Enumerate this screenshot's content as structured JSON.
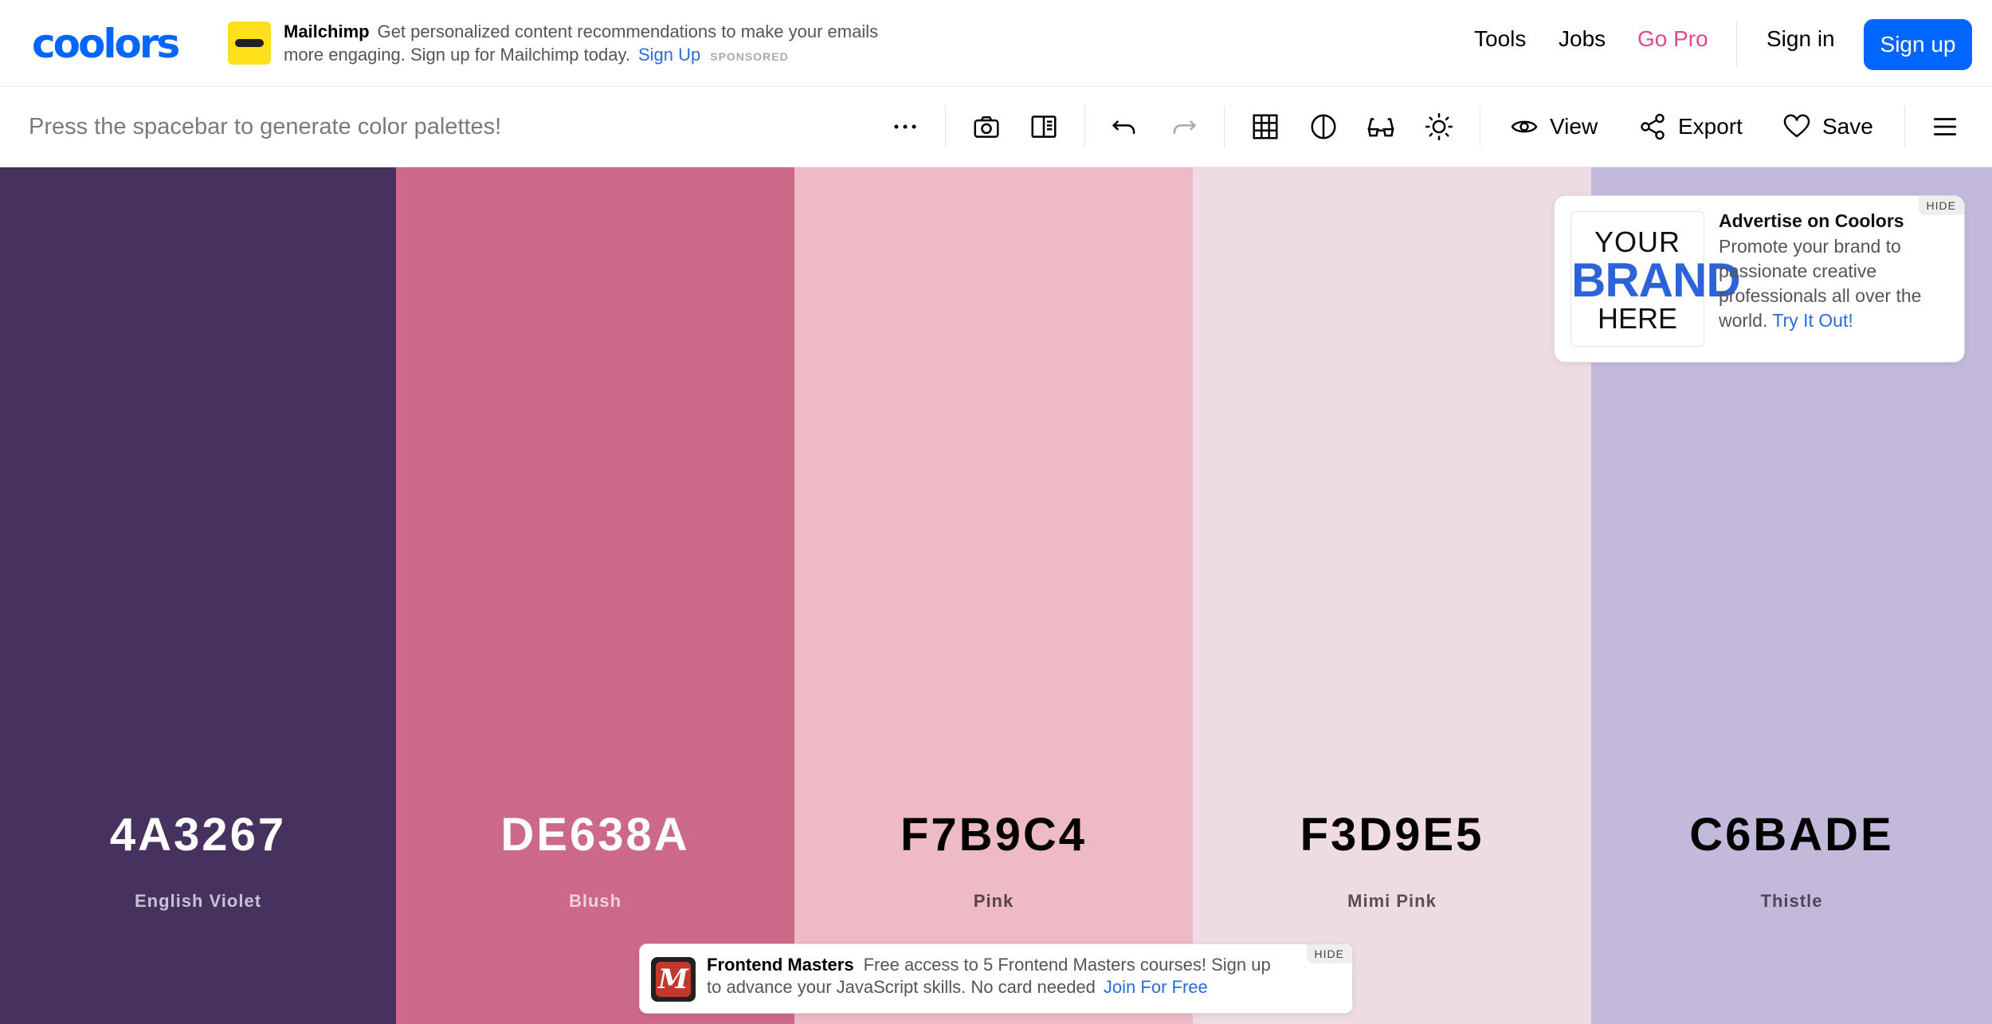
{
  "header": {
    "logo": "coolors",
    "ad": {
      "brand": "Mailchimp",
      "text": "Get personalized content recommendations to make your emails more engaging. Sign up for Mailchimp today.",
      "link": "Sign Up",
      "sponsored": "SPONSORED"
    },
    "nav": {
      "tools": "Tools",
      "jobs": "Jobs",
      "gopro": "Go Pro",
      "signin": "Sign in",
      "signup": "Sign up"
    },
    "colors": {
      "accent": "#0066ff",
      "gopro": "#e0498a"
    }
  },
  "toolbar": {
    "hint": "Press the spacebar to generate color palettes!",
    "icons": [
      "more-icon",
      "camera-icon",
      "side-panel-icon",
      "undo-icon",
      "redo-icon",
      "grid-icon",
      "contrast-icon",
      "glasses-icon",
      "sun-icon",
      "hamburger-icon"
    ],
    "view": "View",
    "export": "Export",
    "save": "Save"
  },
  "palette": [
    {
      "hex": "4A3267",
      "name": "English Violet",
      "bg": "#47325f",
      "text": "#ffffff",
      "sub": "#c9c0d6"
    },
    {
      "hex": "DE638A",
      "name": "Blush",
      "bg": "#cc6988",
      "text": "#ffffff",
      "sub": "#f2cfdb"
    },
    {
      "hex": "F7B9C4",
      "name": "Pink",
      "bg": "#eebac5",
      "text": "#000000",
      "sub": "#5a4448"
    },
    {
      "hex": "F3D9E5",
      "name": "Mimi Pink",
      "bg": "#eedbe3",
      "text": "#000000",
      "sub": "#5a5054"
    },
    {
      "hex": "C6BADE",
      "name": "Thistle",
      "bg": "#c3b9da",
      "text": "#000000",
      "sub": "#4d4858"
    }
  ],
  "ad_card": {
    "brand_line1": "YOUR",
    "brand_line2": "BRAND",
    "brand_line3": "HERE",
    "title": "Advertise on Coolors",
    "body": "Promote your brand to passionate creative professionals all over the world.",
    "link": "Try It Out!",
    "hide": "HIDE"
  },
  "ad_bottom": {
    "logo_letter": "M",
    "brand": "Frontend Masters",
    "text": "Free access to 5 Frontend Masters courses! Sign up to advance your JavaScript skills. No card needed",
    "link": "Join For Free",
    "hide": "HIDE"
  }
}
